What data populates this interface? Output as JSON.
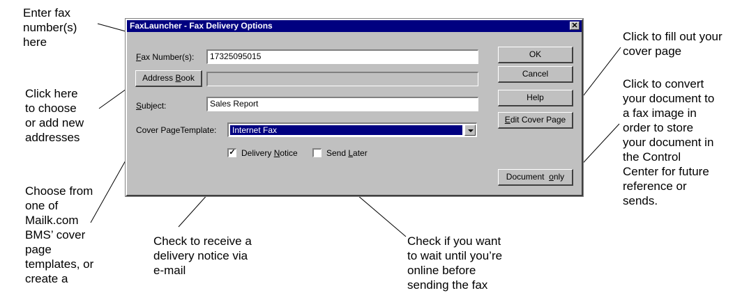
{
  "dialog": {
    "title": "FaxLauncher - Fax Delivery Options",
    "close_glyph": "✕",
    "fax_numbers": {
      "label": "Fax Number(s):",
      "accesskey": "F",
      "value": "17325095015"
    },
    "address_book": {
      "label": "Address Book",
      "accesskey": "B",
      "value": ""
    },
    "subject": {
      "label": "Subject:",
      "accesskey": "S",
      "value": "Sales Report"
    },
    "cover_template": {
      "label": "Cover PageTemplate:",
      "selected": "Internet Fax"
    },
    "delivery_notice": {
      "label": "Delivery Notice",
      "accesskey": "N",
      "checked": true,
      "check_glyph": "✓"
    },
    "send_later": {
      "label": "Send Later",
      "accesskey": "L",
      "checked": false
    },
    "buttons": {
      "ok": "OK",
      "cancel": "Cancel",
      "help": "Help",
      "edit_cover_page": "Edit Cover Page",
      "document_only": "Document  only"
    }
  },
  "callouts": {
    "enter_fax": "Enter fax\nnumber(s)\nhere",
    "address_book": "Click here\nto choose\nor add new\naddresses",
    "cover_templates": "Choose from\none of\nMailk.com\nBMS’ cover\npage\ntemplates, or\ncreate a",
    "delivery_notice": "Check to receive a\ndelivery notice via\ne-mail",
    "send_later": "Check if you want\nto wait until you’re\nonline before\nsending the fax",
    "edit_cover": "Click to fill out your\ncover page",
    "document_only": "Click to convert\nyour document to\na fax image in\norder to store\nyour document in\nthe Control\nCenter for future\nreference or\nsends."
  },
  "colors": {
    "title_bar": "#000080",
    "dialog_face": "#c0c0c0",
    "selection": "#000080"
  },
  "icons": {
    "close": "close-icon",
    "dropdown": "chevron-down-icon",
    "check": "check-icon"
  }
}
